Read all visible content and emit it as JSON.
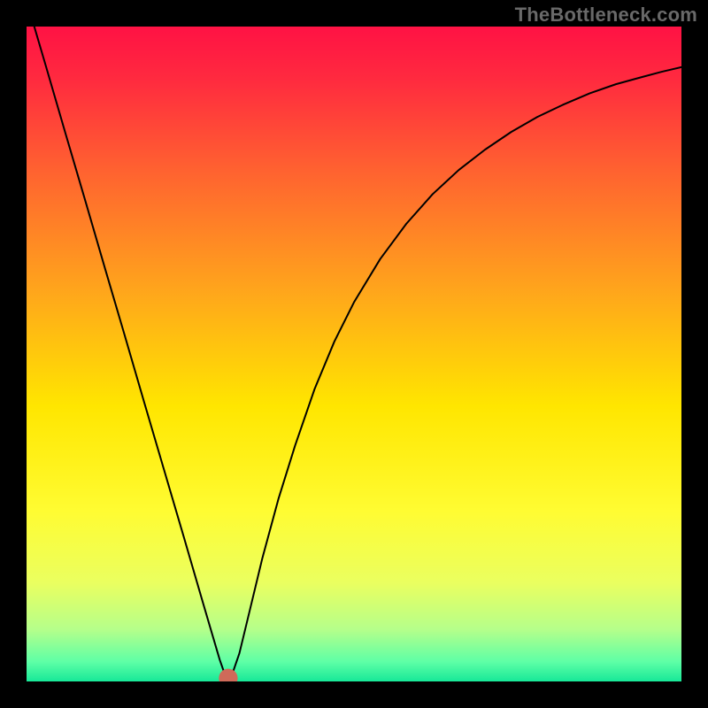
{
  "watermark": "TheBottleneck.com",
  "chart_data": {
    "type": "line",
    "title": "",
    "xlabel": "",
    "ylabel": "",
    "xlim": [
      0,
      100
    ],
    "ylim": [
      0,
      100
    ],
    "grid": false,
    "gradient_stops": [
      {
        "offset": 0.0,
        "color": "#ff1244"
      },
      {
        "offset": 0.08,
        "color": "#ff2a3f"
      },
      {
        "offset": 0.22,
        "color": "#ff6230"
      },
      {
        "offset": 0.4,
        "color": "#ffa41c"
      },
      {
        "offset": 0.58,
        "color": "#ffe600"
      },
      {
        "offset": 0.74,
        "color": "#fffc32"
      },
      {
        "offset": 0.85,
        "color": "#eaff60"
      },
      {
        "offset": 0.92,
        "color": "#b6ff8a"
      },
      {
        "offset": 0.97,
        "color": "#5effa6"
      },
      {
        "offset": 1.0,
        "color": "#17e898"
      }
    ],
    "series": [
      {
        "name": "curve",
        "stroke": "#000000",
        "stroke_width": 2,
        "x": [
          0.0,
          3.0,
          6.0,
          9.0,
          12.0,
          15.0,
          18.0,
          21.0,
          24.0,
          27.0,
          28.5,
          29.5,
          30.2,
          30.8,
          31.5,
          32.5,
          34.0,
          36.0,
          38.5,
          41.0,
          44.0,
          47.0,
          50.0,
          54.0,
          58.0,
          62.0,
          66.0,
          70.0,
          74.0,
          78.0,
          82.0,
          86.0,
          90.0,
          94.0,
          97.0,
          100.0
        ],
        "y": [
          104.0,
          93.8,
          83.5,
          73.3,
          63.0,
          52.8,
          42.5,
          32.3,
          22.1,
          11.8,
          6.7,
          3.3,
          1.3,
          0.5,
          1.4,
          4.3,
          10.5,
          18.8,
          28.0,
          36.0,
          44.7,
          51.9,
          57.9,
          64.5,
          69.9,
          74.4,
          78.1,
          81.2,
          83.9,
          86.2,
          88.1,
          89.8,
          91.2,
          92.3,
          93.1,
          93.8
        ]
      }
    ],
    "marker": {
      "x": 30.8,
      "y": 0.5,
      "r": 1.0,
      "fill": "#cf6a59"
    },
    "colors": {
      "frame": "#000000"
    }
  }
}
